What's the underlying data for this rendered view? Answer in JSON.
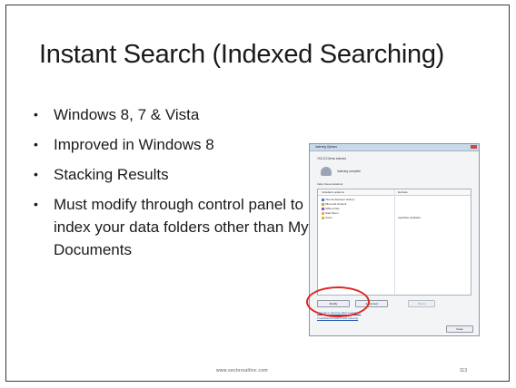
{
  "slide": {
    "title": "Instant Search (Indexed Searching)",
    "bullets": [
      "Windows 8, 7 & Vista",
      "Improved in Windows 8",
      "Stacking Results",
      "Must modify through control panel to index your data folders other than My Documents"
    ],
    "footer": "www.sectorsaltinc.com",
    "page_number": "113"
  },
  "dialog": {
    "title": "Indexing Options",
    "items_indexed": "743,212 items indexed",
    "status": "Indexing complete.",
    "section_label": "Index these locations:",
    "columns": [
      "Included Locations",
      "Exclude"
    ],
    "locations": [
      {
        "name": "Internet Explorer History",
        "exclude": ""
      },
      {
        "name": "Microsoft Outlook",
        "exclude": ""
      },
      {
        "name": "Offline Files",
        "exclude": ""
      },
      {
        "name": "Start Menu",
        "exclude": ""
      },
      {
        "name": "Users",
        "exclude": "AppData; AppData"
      }
    ],
    "buttons": {
      "modify": "Modify",
      "advanced": "Advanced",
      "pause": "Pause",
      "close": "Close"
    },
    "links": [
      "How does indexing affect searches?",
      "Troubleshoot search and indexing"
    ]
  },
  "colors": {
    "highlight": "#e0251f",
    "slide_border": "#3a3a3a"
  }
}
